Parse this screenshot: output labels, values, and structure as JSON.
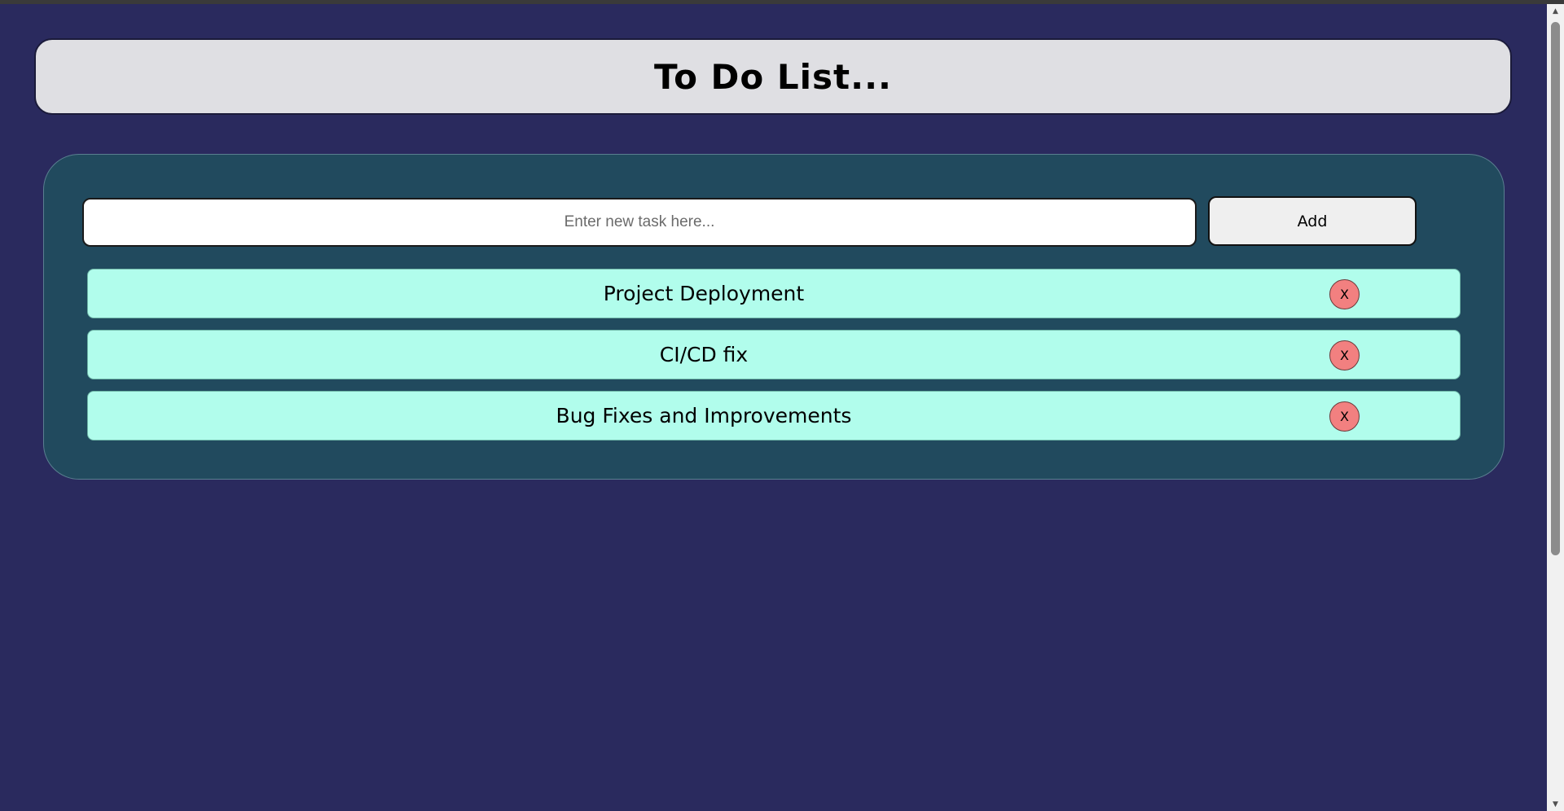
{
  "header": {
    "title": "To Do List..."
  },
  "form": {
    "placeholder": "Enter new task here...",
    "value": "",
    "add_label": "Add"
  },
  "tasks": [
    {
      "label": "Project Deployment",
      "delete_label": "X"
    },
    {
      "label": "CI/CD fix",
      "delete_label": "X"
    },
    {
      "label": "Bug Fixes and Improvements",
      "delete_label": "X"
    }
  ],
  "colors": {
    "background": "#2a2a5e",
    "header_bg": "#dfdfe3",
    "panel_bg": "#214a5e",
    "task_bg": "#b1fdec",
    "delete_bg": "#f28080"
  },
  "icons": {
    "scroll_up": "scroll-up-arrow-icon",
    "scroll_down": "scroll-down-arrow-icon"
  }
}
